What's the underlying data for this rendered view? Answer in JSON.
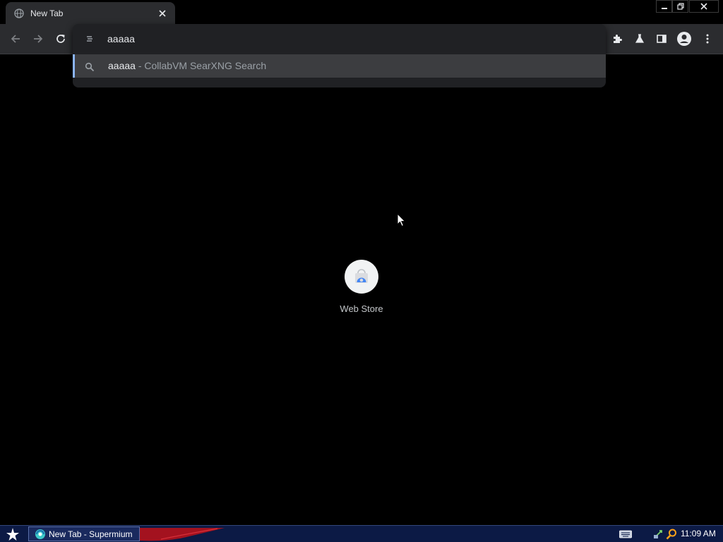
{
  "tab": {
    "title": "New Tab",
    "favicon": "globe-icon"
  },
  "window_controls": {
    "minimize": "minimize-icon",
    "maximize": "restore-icon",
    "close": "close-icon"
  },
  "omnibox": {
    "value": "aaaaa",
    "suggestion": {
      "query": "aaaaa",
      "separator": " - ",
      "source": "CollabVM SearXNG Search"
    },
    "accent_color": "#8ab4f8"
  },
  "shortcut": {
    "label": "Web Store",
    "icon": "web-store-icon"
  },
  "taskbar": {
    "task_label": "New Tab - Supermium",
    "clock": "11:09 AM"
  },
  "colors": {
    "background": "#000000",
    "toolbar": "#2b2c2f",
    "omnibox": "#202124",
    "taskbar": "#0c1a45"
  }
}
